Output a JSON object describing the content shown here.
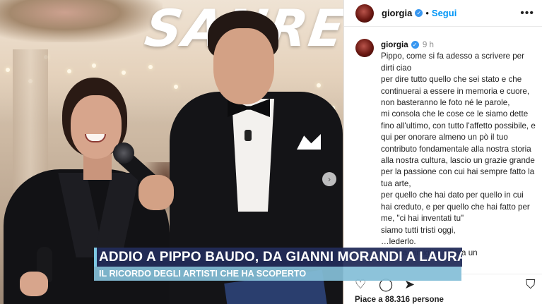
{
  "photo": {
    "backdrop_text": "SANRE"
  },
  "post_header": {
    "username": "giorgia",
    "verified_mark": "✓",
    "separator": "•",
    "follow_label": "Segui",
    "more_icon": "more-horizontal-icon"
  },
  "caption": {
    "username": "giorgia",
    "time": "9 h",
    "lines": [
      "Pippo, come si fa adesso a scrivere per dirti ciao",
      "per dire tutto quello che sei stato e che continuerai a essere in memoria e cuore,",
      "non basteranno le foto né le parole,",
      "mi consola che le cose ce le siamo dette fino all'ultimo, con tutto l'affetto possibile, e qui per onorare almeno un pò il tuo contributo fondamentale alla nostra storia alla nostra cultura, lascio un grazie grande",
      "per la passione con cui hai sempre fatto la tua arte,",
      "per quello che hai dato per quello in cui hai creduto, e per quello che hai fatto per me, \"ci hai inventati tu\"",
      "siamo tutti tristi oggi,",
      "…lederlo.",
      "…a tua famiglia, a Dina un"
    ]
  },
  "actions": {
    "like_icon": "heart-icon",
    "comment_icon": "comment-icon",
    "share_icon": "send-icon",
    "save_icon": "bookmark-icon",
    "likes_text": "Piace a 88.316 persone"
  },
  "lower_third": {
    "title": "ADDIO A PIPPO BAUDO, DA GIANNI MORANDI A LAURA PAUSINI",
    "subtitle": "IL RICORDO DEGLI ARTISTI CHE HA SCOPERTO"
  },
  "colors": {
    "follow_blue": "#0095f6",
    "banner_navy": "#222c58",
    "banner_light_blue": "#84bed7"
  }
}
